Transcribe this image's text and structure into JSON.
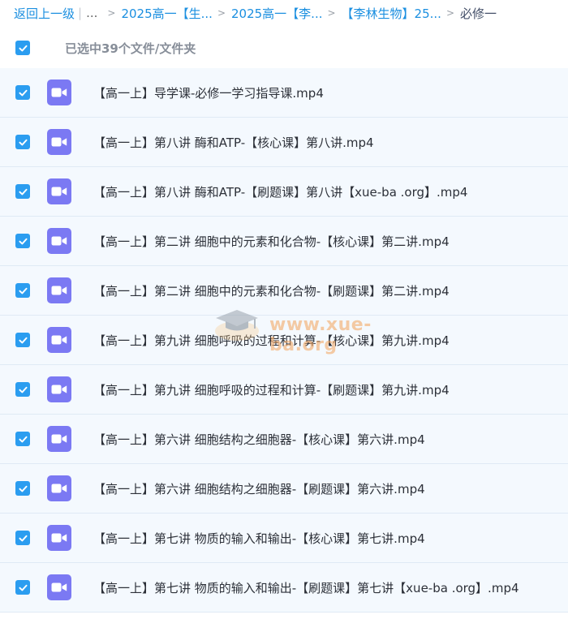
{
  "breadcrumb": {
    "back_label": "返回上一级",
    "separator_bar": "|",
    "ellipsis": "...",
    "separator": ">",
    "items": [
      "2025高一【生...",
      "2025高一【李...",
      "【李林生物】25..."
    ],
    "current": "必修一"
  },
  "selection": {
    "status_text": "已选中39个文件/文件夹",
    "all_checked": true
  },
  "colors": {
    "accent": "#2b9df0",
    "link": "#1b8fe0",
    "video_icon": "#7b79f3",
    "row_bg": "#f4f9fe"
  },
  "files": [
    {
      "name": "【高一上】导学课-必修一学习指导课.mp4",
      "checked": true,
      "icon": "video-file-icon"
    },
    {
      "name": "【高一上】第八讲 酶和ATP-【核心课】第八讲.mp4",
      "checked": true,
      "icon": "video-file-icon"
    },
    {
      "name": "【高一上】第八讲 酶和ATP-【刷题课】第八讲【xue-ba .org】.mp4",
      "checked": true,
      "icon": "video-file-icon"
    },
    {
      "name": "【高一上】第二讲 细胞中的元素和化合物-【核心课】第二讲.mp4",
      "checked": true,
      "icon": "video-file-icon"
    },
    {
      "name": "【高一上】第二讲 细胞中的元素和化合物-【刷题课】第二讲.mp4",
      "checked": true,
      "icon": "video-file-icon"
    },
    {
      "name": "【高一上】第九讲 细胞呼吸的过程和计算-【核心课】第九讲.mp4",
      "checked": true,
      "icon": "video-file-icon"
    },
    {
      "name": "【高一上】第九讲 细胞呼吸的过程和计算-【刷题课】第九讲.mp4",
      "checked": true,
      "icon": "video-file-icon"
    },
    {
      "name": "【高一上】第六讲 细胞结构之细胞器-【核心课】第六讲.mp4",
      "checked": true,
      "icon": "video-file-icon"
    },
    {
      "name": "【高一上】第六讲 细胞结构之细胞器-【刷题课】第六讲.mp4",
      "checked": true,
      "icon": "video-file-icon"
    },
    {
      "name": "【高一上】第七讲 物质的输入和输出-【核心课】第七讲.mp4",
      "checked": true,
      "icon": "video-file-icon"
    },
    {
      "name": "【高一上】第七讲 物质的输入和输出-【刷题课】第七讲【xue-ba .org】.mp4",
      "checked": true,
      "icon": "video-file-icon"
    }
  ],
  "watermark": {
    "text": "www.xue-ba.org",
    "icon": "graduation-cap-icon"
  }
}
